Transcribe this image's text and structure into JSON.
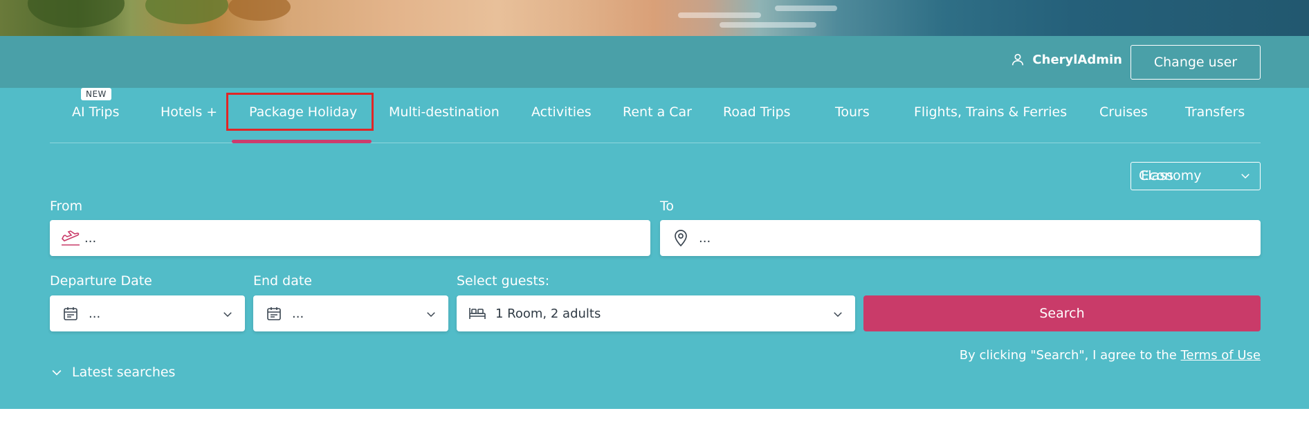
{
  "header": {
    "username": "CherylAdmin",
    "change_user_label": "Change user"
  },
  "tabs": [
    {
      "label": "AI Trips",
      "badge": "NEW"
    },
    {
      "label": "Hotels +"
    },
    {
      "label": "Package Holiday",
      "active": true
    },
    {
      "label": "Multi-destination"
    },
    {
      "label": "Activities"
    },
    {
      "label": "Rent a Car"
    },
    {
      "label": "Road Trips"
    },
    {
      "label": "Tours"
    },
    {
      "label": "Flights, Trains & Ferries"
    },
    {
      "label": "Cruises"
    },
    {
      "label": "Transfers"
    }
  ],
  "search": {
    "class_label": "Class",
    "class_value": "Economy",
    "from_label": "From",
    "from_placeholder": "...",
    "to_label": "To",
    "to_placeholder": "...",
    "departure_label": "Departure Date",
    "departure_value": "...",
    "end_label": "End date",
    "end_value": "...",
    "guests_label": "Select guests:",
    "guests_value": "1 Room, 2 adults",
    "search_label": "Search",
    "terms_prefix": "By clicking \"Search\", I agree to the",
    "terms_link": "Terms of Use",
    "latest_searches_label": "Latest searches"
  },
  "colors": {
    "panel": "#52bcc8",
    "topbar": "#4aa0a8",
    "accent": "#c93b69",
    "highlight": "#e02626"
  },
  "icons": {
    "user": "user-icon",
    "from": "plane-takeoff-icon",
    "to": "map-pin-icon",
    "date": "calendar-icon",
    "guests": "bed-icon",
    "chevron": "chevron-down-icon"
  }
}
